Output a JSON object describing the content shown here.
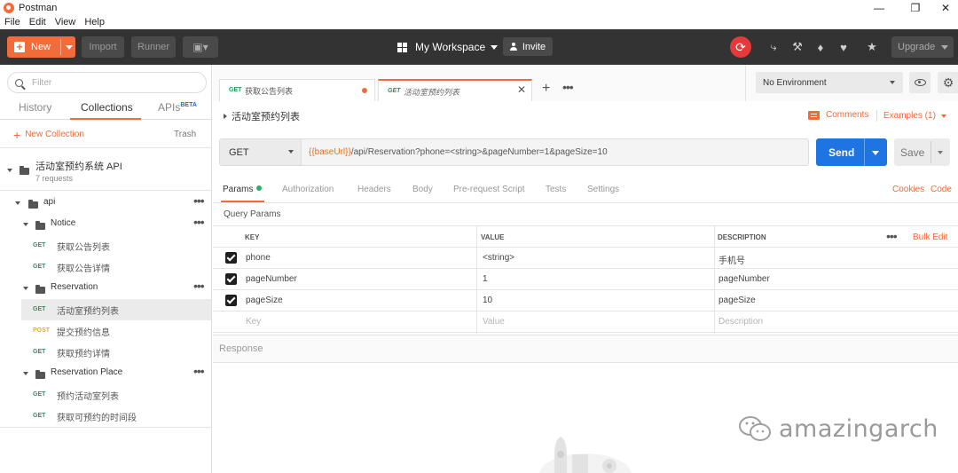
{
  "window": {
    "title": "Postman"
  },
  "menu": [
    "File",
    "Edit",
    "View",
    "Help"
  ],
  "toolbar": {
    "new_label": "New",
    "import_label": "Import",
    "runner_label": "Runner",
    "workspace_label": "My Workspace",
    "invite_label": "Invite",
    "upgrade_label": "Upgrade"
  },
  "sidebar": {
    "filter_placeholder": "Filter",
    "tabs": {
      "history": "History",
      "collections": "Collections",
      "apis": "APIs",
      "apis_badge": "BETA"
    },
    "new_collection": "New Collection",
    "trash": "Trash",
    "collection": {
      "name": "活动室预约系统 API",
      "count": "7 requests"
    },
    "folders": {
      "api": "api",
      "notice": "Notice",
      "reservation": "Reservation",
      "reservation_place": "Reservation Place"
    },
    "requests": [
      {
        "method": "GET",
        "name": "获取公告列表"
      },
      {
        "method": "GET",
        "name": "获取公告详情"
      },
      {
        "method": "GET",
        "name": "活动室预约列表"
      },
      {
        "method": "POST",
        "name": "提交预约信息"
      },
      {
        "method": "GET",
        "name": "获取预约详情"
      },
      {
        "method": "GET",
        "name": "预约活动室列表"
      },
      {
        "method": "GET",
        "name": "获取可预约的时间段"
      }
    ]
  },
  "tabs": [
    {
      "method": "GET",
      "name": "获取公告列表"
    },
    {
      "method": "GET",
      "name": "活动室预约列表"
    }
  ],
  "environment": {
    "selected": "No Environment"
  },
  "request": {
    "title": "活动室预约列表",
    "comments_label": "Comments",
    "examples_label": "Examples (1)",
    "method": "GET",
    "url_var": "{{baseUrl}}",
    "url_rest": "/api/Reservation?phone=<string>&pageNumber=1&pageSize=10",
    "send_label": "Send",
    "save_label": "Save"
  },
  "param_tabs": [
    "Params",
    "Authorization",
    "Headers",
    "Body",
    "Pre-request Script",
    "Tests",
    "Settings"
  ],
  "param_links": {
    "cookies": "Cookies",
    "code": "Code"
  },
  "query_params": {
    "title": "Query Params",
    "headers": {
      "key": "KEY",
      "value": "VALUE",
      "description": "DESCRIPTION"
    },
    "bulk_edit": "Bulk Edit",
    "rows": [
      {
        "key": "phone",
        "value": "<string>",
        "description": "手机号"
      },
      {
        "key": "pageNumber",
        "value": "1",
        "description": "pageNumber"
      },
      {
        "key": "pageSize",
        "value": "10",
        "description": "pageSize"
      }
    ],
    "placeholders": {
      "key": "Key",
      "value": "Value",
      "description": "Description"
    }
  },
  "response": {
    "label": "Response"
  },
  "watermark": {
    "text": "amazingarch"
  },
  "colors": {
    "accent": "#f26b3a",
    "send": "#1e74e1",
    "get": "#1f9a5c",
    "post": "#e4b41b"
  }
}
